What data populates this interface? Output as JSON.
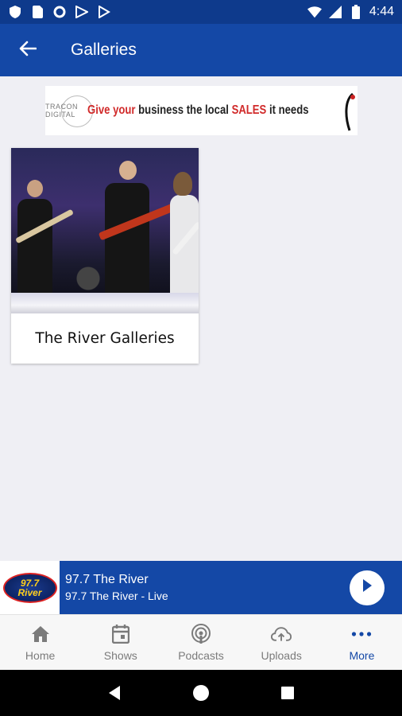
{
  "status_bar": {
    "time": "4:44",
    "icons": [
      "shield-icon",
      "sim-card-icon",
      "circle-icon",
      "flag-icon",
      "play-store-icon"
    ],
    "right_icons": [
      "wifi-icon",
      "signal-icon",
      "battery-icon"
    ]
  },
  "app_bar": {
    "title": "Galleries",
    "back_icon": "arrow-back-icon"
  },
  "ad": {
    "brand": "TRACON DIGITAL",
    "text_part1": "Give your",
    "text_part2": " business the local ",
    "text_part3": "SALES",
    "text_part4": " it needs"
  },
  "galleries": [
    {
      "title": "The River Galleries"
    }
  ],
  "player": {
    "logo_line1": "97.7",
    "logo_line2": "River",
    "station": "97.7 The River",
    "subtitle": "97.7 The River - Live"
  },
  "bottom_nav": {
    "items": [
      {
        "label": "Home",
        "icon": "home-icon",
        "active": false
      },
      {
        "label": "Shows",
        "icon": "calendar-icon",
        "active": false
      },
      {
        "label": "Podcasts",
        "icon": "podcast-icon",
        "active": false
      },
      {
        "label": "Uploads",
        "icon": "cloud-upload-icon",
        "active": false
      },
      {
        "label": "More",
        "icon": "more-icon",
        "active": true
      }
    ]
  },
  "colors": {
    "status_bar": "#0e3a8c",
    "primary": "#1448a6",
    "background": "#efeff4",
    "nav_inactive": "#7b7b7b",
    "ad_red": "#d12b2b"
  }
}
